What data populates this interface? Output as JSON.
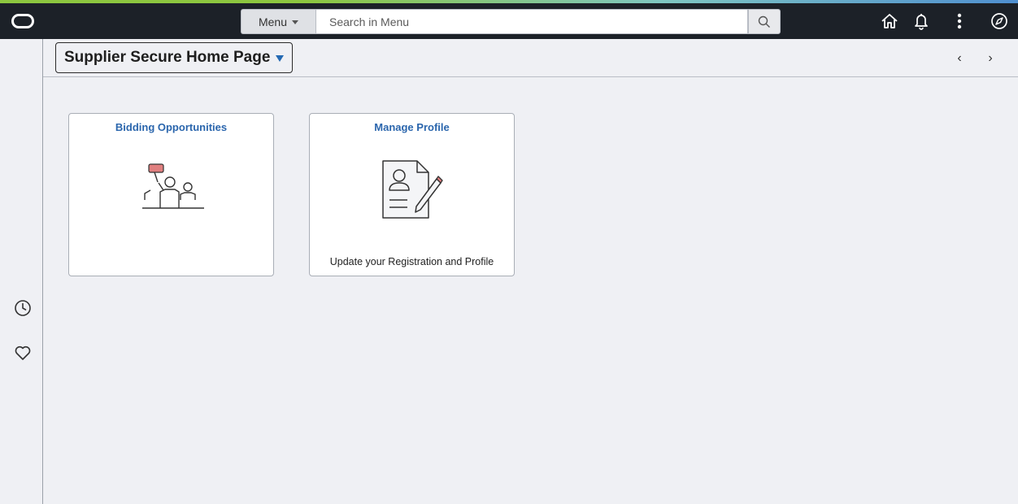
{
  "header": {
    "menu_label": "Menu",
    "search_placeholder": "Search in Menu",
    "icons": [
      "oracle-logo",
      "search-icon",
      "home-icon",
      "bell-icon",
      "more-vertical-icon",
      "navbar-compass-icon"
    ]
  },
  "title_bar": {
    "page_title": "Supplier Secure Home Page",
    "prev_label": "‹",
    "next_label": "›"
  },
  "sidebar": {
    "icons": [
      "recent-clock-icon",
      "favorites-heart-icon"
    ]
  },
  "tiles": [
    {
      "title": "Bidding Opportunities",
      "description": "",
      "icon": "auction-bidders-icon"
    },
    {
      "title": "Manage Profile",
      "description": "Update your Registration and Profile",
      "icon": "profile-document-pencil-icon"
    }
  ],
  "colors": {
    "header_bg": "#1c2128",
    "page_bg": "#eff0f4",
    "tile_title": "#2b66ad",
    "accent_green": "#8cc63f",
    "accent_blue": "#4f8fd0",
    "icon_red": "#e07f7f"
  }
}
